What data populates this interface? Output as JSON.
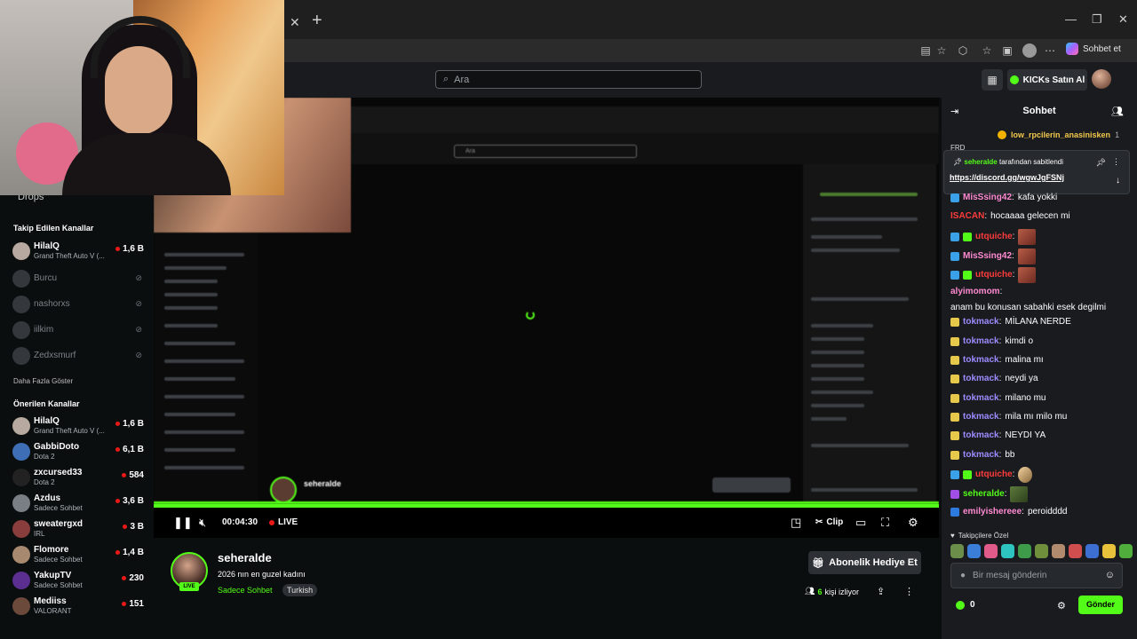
{
  "browser": {
    "copilot_label": "Sohbet et"
  },
  "header": {
    "search_placeholder": "Ara",
    "kicks_label": "KICKs Satın Al"
  },
  "sidebar": {
    "drops": "Drops",
    "followed_heading": "Takip Edilen Kanallar",
    "show_more": "Daha Fazla Göster",
    "recommended_heading": "Önerilen Kanallar",
    "followed": [
      {
        "name": "HilalQ",
        "sub": "Grand Theft Auto V (...",
        "count": "1,6 B",
        "online": true
      },
      {
        "name": "Burcu",
        "online": false
      },
      {
        "name": "nashorxs",
        "online": false
      },
      {
        "name": "iilkim",
        "online": false
      },
      {
        "name": "Zedxsmurf",
        "online": false
      }
    ],
    "recommended": [
      {
        "name": "HilalQ",
        "sub": "Grand Theft Auto V (...",
        "count": "1,6 B"
      },
      {
        "name": "GabbiDoto",
        "sub": "Dota 2",
        "count": "6,1 B"
      },
      {
        "name": "zxcursed33",
        "sub": "Dota 2",
        "count": "584"
      },
      {
        "name": "Azdus",
        "sub": "Sadece Sohbet",
        "count": "3,6 B"
      },
      {
        "name": "sweatergxd",
        "sub": "IRL",
        "count": "3 B"
      },
      {
        "name": "Flomore",
        "sub": "Sadece Sohbet",
        "count": "1,4 B"
      },
      {
        "name": "YakupTV",
        "sub": "Sadece Sohbet",
        "count": "230"
      },
      {
        "name": "Mediiss",
        "sub": "VALORANT",
        "count": "151"
      }
    ]
  },
  "player": {
    "time": "00:04:30",
    "live": "LIVE",
    "clip": "Clip",
    "progress": 1.0
  },
  "nested": {
    "streamer": "seheralde",
    "search": "Ara"
  },
  "stream": {
    "name": "seheralde",
    "title": "2026 nın en guzel kadını",
    "category": "Sadece Sohbet",
    "tag": "Turkish",
    "live_badge": "LIVE",
    "subscribe_gift": "Abonelik Hediye Et",
    "viewers_count": "6",
    "viewers_label": "kişi izliyor"
  },
  "chat": {
    "title": "Sohbet",
    "top_gifter": "low_rpcilerin_anasinisken",
    "top_gifter_count": "1",
    "frd": "FRD",
    "pinned_by": "seheralde",
    "pinned_suffix": "tarafından sabitlendi",
    "pinned_link": "https://discord.gg/wgwJgFSNj",
    "messages": [
      {
        "user": "MisSsing42",
        "color": "#ff8ad1",
        "text": "kafa yokki",
        "badges": [
          "#3aa0e8"
        ]
      },
      {
        "user": "ISACAN",
        "color": "#ff3b3b",
        "text": "hocaaaa gelecen mi",
        "badges": []
      },
      {
        "user": "utquiche",
        "color": "#ff3b3b",
        "text": "",
        "emote": "red",
        "badges": [
          "#3aa0e8",
          "#53fc18"
        ]
      },
      {
        "user": "MisSsing42",
        "color": "#ff8ad1",
        "text": "",
        "emote": "red",
        "badges": [
          "#3aa0e8"
        ]
      },
      {
        "user": "utquiche",
        "color": "#ff3b3b",
        "text": "",
        "emote": "red",
        "badges": [
          "#3aa0e8",
          "#53fc18"
        ]
      },
      {
        "user": "alyimomom",
        "color": "#ff8ad1",
        "text": "anam bu konusan sabahki esek degilmi",
        "badges": []
      },
      {
        "user": "tokmack",
        "color": "#9c8cff",
        "text": "MİLANA NERDE",
        "badges": [
          "#e6c84a"
        ]
      },
      {
        "user": "tokmack",
        "color": "#9c8cff",
        "text": "kimdi o",
        "badges": [
          "#e6c84a"
        ]
      },
      {
        "user": "tokmack",
        "color": "#9c8cff",
        "text": "malina mı",
        "badges": [
          "#e6c84a"
        ]
      },
      {
        "user": "tokmack",
        "color": "#9c8cff",
        "text": "neydi ya",
        "badges": [
          "#e6c84a"
        ]
      },
      {
        "user": "tokmack",
        "color": "#9c8cff",
        "text": "milano mu",
        "badges": [
          "#e6c84a"
        ]
      },
      {
        "user": "tokmack",
        "color": "#9c8cff",
        "text": "mila mı milo mu",
        "badges": [
          "#e6c84a"
        ]
      },
      {
        "user": "tokmack",
        "color": "#9c8cff",
        "text": "NEYDI YA",
        "badges": [
          "#e6c84a"
        ]
      },
      {
        "user": "tokmack",
        "color": "#9c8cff",
        "text": "bb",
        "badges": [
          "#e6c84a"
        ]
      },
      {
        "user": "utquiche",
        "color": "#ff3b3b",
        "text": "",
        "emote": "face",
        "badges": [
          "#3aa0e8",
          "#53fc18"
        ]
      },
      {
        "user": "seheralde",
        "color": "#53fc18",
        "text": "",
        "emote": "green",
        "badges": [
          "#a14ee6"
        ]
      },
      {
        "user": "emilyishereee",
        "color": "#ff8ad1",
        "text": "peroidddd",
        "badges": [
          "#2e7be0"
        ]
      }
    ],
    "favorites_label": "Takipçilere Özel",
    "input_placeholder": "Bir mesaj gönderin",
    "points": "0",
    "send": "Gönder"
  },
  "colors": {
    "accent": "#53fc18",
    "background": "#0b0e0f",
    "panel": "#191b1f"
  }
}
